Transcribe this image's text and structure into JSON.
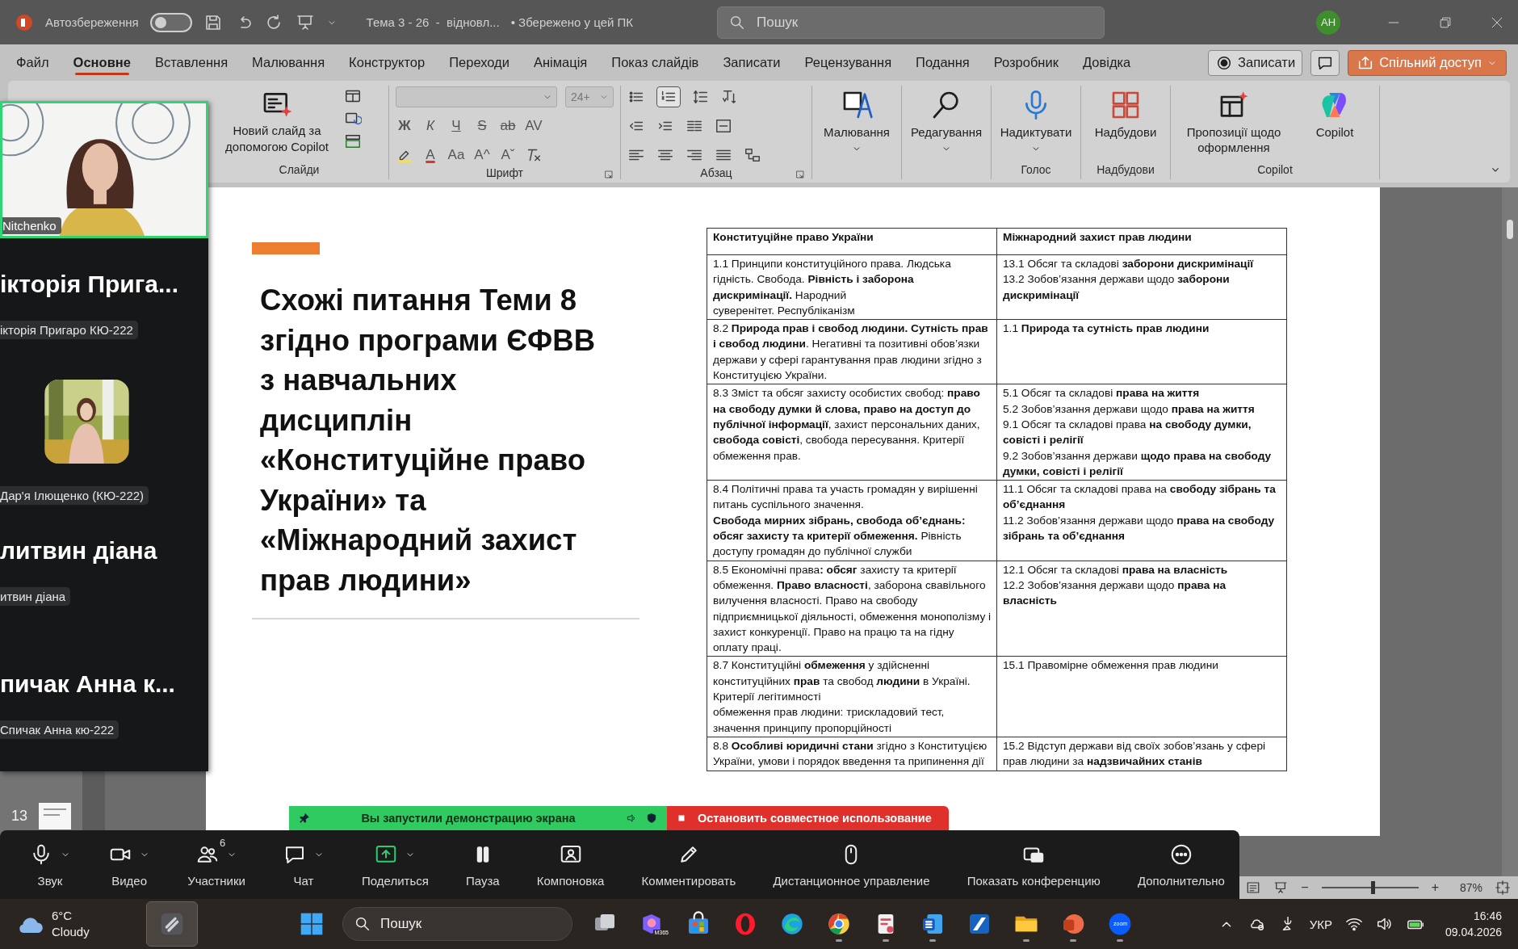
{
  "title_bar": {
    "autosave_label": "Автозбереження",
    "autosave_on": false,
    "document_title": "Тема 3 - 26  -  відновл...",
    "save_status": "• Збережено у цей ПК",
    "search_placeholder": "Пошук",
    "avatar": "AH"
  },
  "menu_tabs": [
    {
      "label": "Файл",
      "selected": false
    },
    {
      "label": "Основне",
      "selected": true
    },
    {
      "label": "Вставлення",
      "selected": false
    },
    {
      "label": "Малювання",
      "selected": false
    },
    {
      "label": "Конструктор",
      "selected": false
    },
    {
      "label": "Переходи",
      "selected": false
    },
    {
      "label": "Анімація",
      "selected": false
    },
    {
      "label": "Показ слайдів",
      "selected": false
    },
    {
      "label": "Записати",
      "selected": false
    },
    {
      "label": "Рецензування",
      "selected": false
    },
    {
      "label": "Подання",
      "selected": false
    },
    {
      "label": "Розробник",
      "selected": false
    },
    {
      "label": "Довідка",
      "selected": false
    }
  ],
  "menu_actions": {
    "record": "Записати",
    "share": "Спільний доступ"
  },
  "ribbon": {
    "slides_group": {
      "new_slide": "Новий слайд за допомогою Copilot",
      "label": "Слайди"
    },
    "font_group": {
      "font_size": "24+",
      "format_buttons": [
        "Ж",
        "К",
        "Ч",
        "S",
        "ab",
        "AV"
      ],
      "color_letter": "A",
      "case_button": "Aa",
      "grow_button": "A^",
      "shrink_button": "Aˇ",
      "label": "Шрифт"
    },
    "paragraph_group": {
      "label": "Абзац",
      "numbering_active": true
    },
    "tool_groups": [
      {
        "buttons": [
          {
            "label": "Малювання",
            "dropdown": true
          }
        ]
      },
      {
        "buttons": [
          {
            "label": "Редагування",
            "dropdown": true
          }
        ]
      },
      {
        "label": "Голос",
        "buttons": [
          {
            "label": "Надиктувати",
            "dropdown": true
          }
        ]
      },
      {
        "label": "Надбудови",
        "buttons": [
          {
            "label": "Надбудови",
            "dropdown": false
          }
        ]
      },
      {
        "label": "Copilot",
        "buttons": [
          {
            "label": "Пропозиції щодо оформлення",
            "dropdown": false
          },
          {
            "label": "Copilot",
            "dropdown": false
          }
        ]
      }
    ]
  },
  "slide": {
    "title": "Схожі питання Теми 8\nзгідно програми ЄФВВ\nз навчальних\nдисциплін\n«Конституційне право\nУкраїни» та\n«Міжнародний захист\nправ людини»",
    "table": {
      "columns": [
        "Конституційне право України",
        "Міжнародний захист прав людини"
      ],
      "rows": [
        {
          "left": "1.1 Принципи конституційного права. Людська гідність. Свобода. **Рівність і заборона дискримінації.** Народний\nсуверенітет. Республіканізм",
          "right": [
            "13.1 Обсяг та складові **заборони дискримінації**",
            "13.2 Зобов’язання держави щодо **заборони дискримінації**"
          ]
        },
        {
          "left": "8.2 **Природа прав і свобод людини. Сутність прав і свобод людини**. Негативні та позитивні обов’язки держави у сфері гарантування прав людини згідно з Конституцією України.",
          "right": [
            "1.1 **Природа та сутність прав людини**"
          ]
        },
        {
          "left": "8.3 Зміст та обсяг захисту особистих свобод: **право на свободу думки й слова, право на доступ до публічної інформації**, захист персональних даних, **свобода совісті**, свобода пересування. Критерії обмеження прав.",
          "right": [
            "5.1 Обсяг та складові **права на життя**",
            "5.2 Зобов’язання держави щодо **права на життя**",
            "9.1 Обсяг та складові права **на свободу думки, совісті і релігії**",
            "9.2 Зобов’язання держави **щодо права на свободу думки, совісті і релігії**"
          ]
        },
        {
          "left": "8.4 Політичні права та участь громадян у вирішенні питань суспільного значення.\n**Свобода мирних зібрань, свобода об’єднань: обсяг захисту та критерії обмеження.** Рівність доступу громадян до публічної служби",
          "right": [
            "11.1 Обсяг та складові права на **свободу зібрань та об’єднання**",
            "11.2 Зобов’язання держави щодо **права на свободу зібрань та об’єднання**"
          ]
        },
        {
          "left": "8.5 Економічні права**: обсяг** захисту та критерії обмеження. **Право власності**, заборона свавільного вилучення власності. Право на свободу підприємницької діяльності, обмеження монополізму і захист конкуренції. Право на працю та на гідну оплату праці.",
          "right": [
            "12.1 Обсяг та складові **права на власність**",
            "12.2 Зобов’язання держави щодо **права на власність**"
          ]
        },
        {
          "left": "8.7 Конституційні **обмеження** у здійсненні конституційних **прав** та свобод **людини** в Україні. Критерії легітимності\nобмеження прав людини: трискладовий тест, значення принципу пропорційності",
          "right": [
            "15.1 Правомірне обмеження прав людини"
          ]
        },
        {
          "left": "8.8 **Особливі юридичні стани** згідно з Конституцією України, умови і порядок введення та припинення дії",
          "right": [
            "15.2 Відступ держави від своїх зобов’язань у сфері прав людини за **надзвичайних станів**"
          ]
        }
      ]
    }
  },
  "thumbnails": [
    {
      "number": "13"
    }
  ],
  "zoom_panel": {
    "video_name": "Nitchenko",
    "participants": [
      {
        "kind": "name",
        "display": "ікторія Прига...",
        "label": "ікторія Пригаро КЮ-222"
      },
      {
        "label": "Дар'я Ілющенко (КЮ-222)"
      },
      {
        "kind": "name",
        "display": "литвин діана",
        "label": "итвин діана"
      },
      {
        "kind": "name",
        "display": "пичак Анна к...",
        "label": "Спичак Анна кю-222"
      }
    ]
  },
  "share_banner": {
    "message": "Вы запустили демонстрацию экрана",
    "stop": "Остановить совместное использование"
  },
  "zoom_toolbar": [
    {
      "label": "Звук",
      "caret": true
    },
    {
      "label": "Видео",
      "caret": true
    },
    {
      "label": "Участники",
      "caret": true,
      "count": "6"
    },
    {
      "label": "Чат",
      "caret": true
    },
    {
      "label": "Поделиться",
      "caret": true
    },
    {
      "label": "Пауза",
      "caret": false
    },
    {
      "label": "Компоновка",
      "caret": false
    },
    {
      "label": "Комментировать",
      "caret": false
    },
    {
      "label": "Дистанционное управление",
      "caret": false
    },
    {
      "label": "Показать конференцию",
      "caret": false
    },
    {
      "label": "Дополнительно",
      "caret": false
    }
  ],
  "status_bar": {
    "zoom_out": "−",
    "zoom_in": "+",
    "level": 0.53,
    "zoom": "87%"
  },
  "taskbar": {
    "temperature": "6°C",
    "weather": "Cloudy",
    "search_placeholder": "Пошук",
    "apps": [
      {
        "running": false
      },
      {
        "running": false,
        "caption": "M365"
      },
      {
        "running": false
      },
      {
        "running": false
      },
      {
        "running": false
      },
      {
        "running": true
      },
      {
        "running": true
      },
      {
        "running": true
      },
      {
        "running": false
      },
      {
        "running": true
      },
      {
        "running": true
      },
      {
        "running": true,
        "caption": "zoom"
      }
    ],
    "language": "УКР",
    "time": "16:46",
    "date": "09.04.2026"
  }
}
